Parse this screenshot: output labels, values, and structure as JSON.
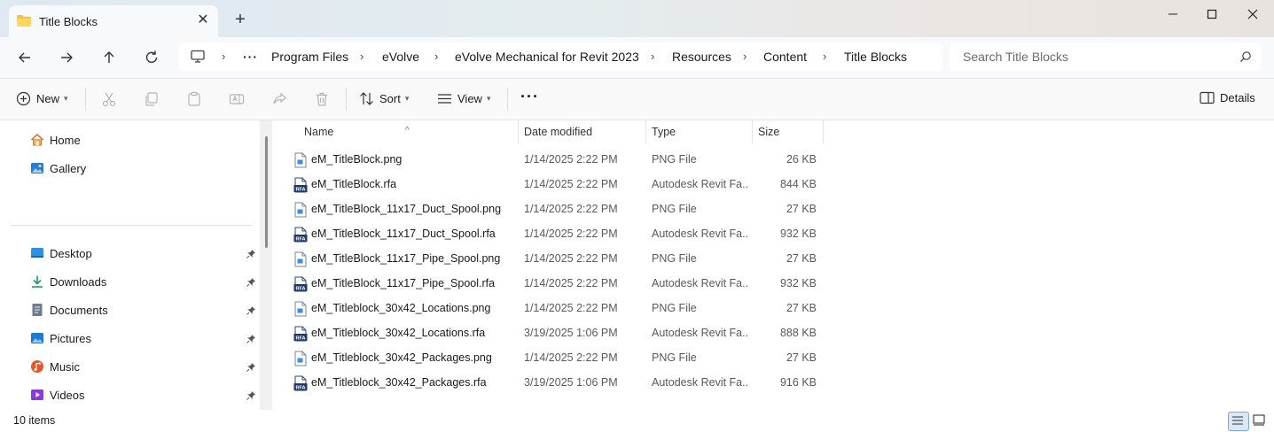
{
  "tab": {
    "title": "Title Blocks",
    "close_glyph": "✕",
    "new_glyph": "+"
  },
  "window": {
    "minimize": "—",
    "maximize": "☐",
    "close": "✕"
  },
  "breadcrumb": {
    "ellipsis": "···",
    "items": [
      "Program Files",
      "eVolve",
      "eVolve Mechanical for Revit 2023",
      "Resources",
      "Content",
      "Title Blocks"
    ]
  },
  "search": {
    "placeholder": "Search Title Blocks"
  },
  "toolbar": {
    "new_label": "New",
    "sort_label": "Sort",
    "view_label": "View",
    "more_glyph": "···",
    "details_label": "Details"
  },
  "sidebar": {
    "top": [
      {
        "label": "Home"
      },
      {
        "label": "Gallery"
      }
    ],
    "quick": [
      {
        "label": "Desktop"
      },
      {
        "label": "Downloads"
      },
      {
        "label": "Documents"
      },
      {
        "label": "Pictures"
      },
      {
        "label": "Music"
      },
      {
        "label": "Videos"
      }
    ]
  },
  "columns": {
    "name": "Name",
    "date": "Date modified",
    "type": "Type",
    "size": "Size"
  },
  "files": [
    {
      "name": "eM_TitleBlock.png",
      "date": "1/14/2025 2:22 PM",
      "type": "PNG File",
      "size": "26 KB",
      "kind": "png"
    },
    {
      "name": "eM_TitleBlock.rfa",
      "date": "1/14/2025 2:22 PM",
      "type": "Autodesk Revit Fa...",
      "size": "844 KB",
      "kind": "rfa"
    },
    {
      "name": "eM_TitleBlock_11x17_Duct_Spool.png",
      "date": "1/14/2025 2:22 PM",
      "type": "PNG File",
      "size": "27 KB",
      "kind": "png"
    },
    {
      "name": "eM_TitleBlock_11x17_Duct_Spool.rfa",
      "date": "1/14/2025 2:22 PM",
      "type": "Autodesk Revit Fa...",
      "size": "932 KB",
      "kind": "rfa"
    },
    {
      "name": "eM_TitleBlock_11x17_Pipe_Spool.png",
      "date": "1/14/2025 2:22 PM",
      "type": "PNG File",
      "size": "27 KB",
      "kind": "png"
    },
    {
      "name": "eM_TitleBlock_11x17_Pipe_Spool.rfa",
      "date": "1/14/2025 2:22 PM",
      "type": "Autodesk Revit Fa...",
      "size": "932 KB",
      "kind": "rfa"
    },
    {
      "name": "eM_Titleblock_30x42_Locations.png",
      "date": "1/14/2025 2:22 PM",
      "type": "PNG File",
      "size": "27 KB",
      "kind": "png"
    },
    {
      "name": "eM_Titleblock_30x42_Locations.rfa",
      "date": "3/19/2025 1:06 PM",
      "type": "Autodesk Revit Fa...",
      "size": "888 KB",
      "kind": "rfa"
    },
    {
      "name": "eM_Titleblock_30x42_Packages.png",
      "date": "1/14/2025 2:22 PM",
      "type": "PNG File",
      "size": "27 KB",
      "kind": "png"
    },
    {
      "name": "eM_Titleblock_30x42_Packages.rfa",
      "date": "3/19/2025 1:06 PM",
      "type": "Autodesk Revit Fa...",
      "size": "916 KB",
      "kind": "rfa"
    }
  ],
  "rfa_badge": "RFA",
  "status": {
    "count": "10 items"
  },
  "colors": {
    "accent": "#0067c0",
    "folder": "#f4c247"
  }
}
